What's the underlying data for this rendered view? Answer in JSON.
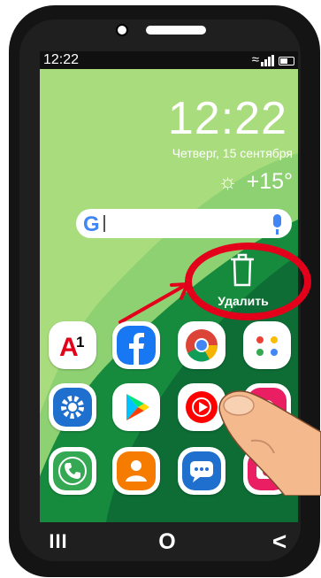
{
  "status_bar": {
    "time": "12:22"
  },
  "lock_widget": {
    "clock": "12:22",
    "date": "Четверг,  15  сентября",
    "temperature": "+15°"
  },
  "search_bar": {
    "logo": "G",
    "placeholder": ""
  },
  "delete_zone": {
    "label": "Удалить"
  },
  "apps": [
    {
      "name": "A1",
      "icon": "a1-icon",
      "color": "#e3001b"
    },
    {
      "name": "Facebook",
      "icon": "facebook-icon",
      "color": "#1877f2"
    },
    {
      "name": "Chrome",
      "icon": "chrome-icon",
      "color": "#ffffff"
    },
    {
      "name": "Google apps",
      "icon": "google-apps-icon",
      "color": "#ffffff"
    },
    {
      "name": "Settings",
      "icon": "settings-icon",
      "color": "#1f6fcf"
    },
    {
      "name": "Play Store",
      "icon": "play-store-icon",
      "color": "#ffffff"
    },
    {
      "name": "YouTube Music",
      "icon": "music-icon",
      "color": "#ff0000"
    },
    {
      "name": "Gallery",
      "icon": "gallery-icon",
      "color": "#e91e63"
    },
    {
      "name": "Phone",
      "icon": "phone-icon",
      "color": "#34a853"
    },
    {
      "name": "Contacts",
      "icon": "contacts-icon",
      "color": "#f57c00"
    },
    {
      "name": "Messages",
      "icon": "messages-icon",
      "color": "#1f6fcf"
    },
    {
      "name": "Camera",
      "icon": "camera-icon",
      "color": "#e91e63"
    }
  ],
  "navigation": {
    "recents": "III",
    "home": "O",
    "back": "<"
  },
  "colors": {
    "wallpaper_light": "#8ed173",
    "wallpaper_dark": "#0d7a3a",
    "highlight_red": "#e3001b"
  }
}
